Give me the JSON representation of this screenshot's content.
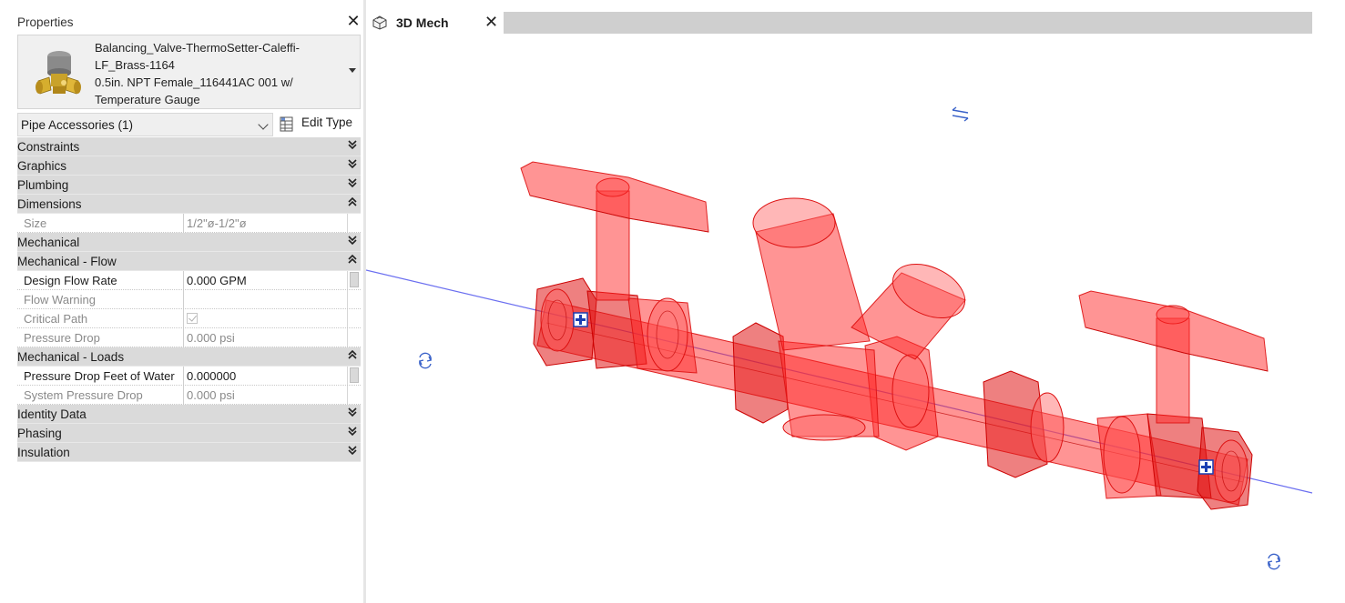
{
  "properties": {
    "title": "Properties",
    "close_glyph": "✕",
    "type_selector": {
      "lines": [
        "Balancing_Valve-ThermoSetter-Caleffi-",
        "LF_Brass-1164",
        "0.5in. NPT Female_116441AC 001 w/",
        "Temperature Gauge"
      ],
      "thumbnail_icon": "brass-balancing-valve-icon"
    },
    "filter": {
      "label": "Pipe Accessories (1)"
    },
    "edit_type_label": "Edit Type",
    "groups": [
      {
        "label": "Constraints",
        "state": "collapsed",
        "chevron": "»",
        "rows": []
      },
      {
        "label": "Graphics",
        "state": "collapsed",
        "chevron": "»",
        "rows": []
      },
      {
        "label": "Plumbing",
        "state": "collapsed",
        "chevron": "»",
        "rows": []
      },
      {
        "label": "Dimensions",
        "state": "expanded",
        "chevron": "«",
        "rows": [
          {
            "name": "Size",
            "value": "1/2\"ø-1/2\"ø",
            "editable": false
          }
        ]
      },
      {
        "label": "Mechanical",
        "state": "collapsed",
        "chevron": "»",
        "rows": []
      },
      {
        "label": "Mechanical - Flow",
        "state": "expanded",
        "chevron": "«",
        "rows": [
          {
            "name": "Design Flow Rate",
            "value": "0.000 GPM",
            "editable": true,
            "button": true
          },
          {
            "name": "Flow Warning",
            "value": "",
            "editable": false
          },
          {
            "name": "Critical Path",
            "value": "",
            "editable": false,
            "checkbox": true,
            "checked": true
          },
          {
            "name": "Pressure Drop",
            "value": "0.000 psi",
            "editable": false
          }
        ]
      },
      {
        "label": "Mechanical - Loads",
        "state": "expanded",
        "chevron": "«",
        "rows": [
          {
            "name": "Pressure Drop Feet of Water",
            "value": "0.000000",
            "editable": true,
            "button": true
          },
          {
            "name": "System Pressure Drop",
            "value": "0.000 psi",
            "editable": false
          }
        ]
      },
      {
        "label": "Identity Data",
        "state": "collapsed",
        "chevron": "»",
        "rows": []
      },
      {
        "label": "Phasing",
        "state": "collapsed",
        "chevron": "»",
        "rows": []
      },
      {
        "label": "Insulation",
        "state": "collapsed",
        "chevron": "»",
        "rows": []
      }
    ]
  },
  "view": {
    "tab_label": "3D Mech",
    "tab_icon": "3d-view-house-icon",
    "tab_close_glyph": "✕",
    "selection_color": "#ff2a2a",
    "connector_line_color": "#6b6ff0",
    "controls": [
      "flip-arrows-icon",
      "rotate-icon",
      "rotate-icon",
      "connector-grip-icon",
      "connector-grip-icon"
    ]
  }
}
